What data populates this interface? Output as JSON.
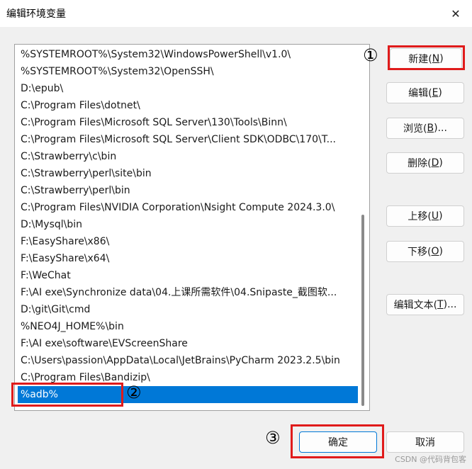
{
  "window": {
    "title": "编辑环境变量",
    "close_glyph": "✕"
  },
  "path_list": {
    "items": [
      "%SYSTEMROOT%\\System32\\WindowsPowerShell\\v1.0\\",
      "%SYSTEMROOT%\\System32\\OpenSSH\\",
      "D:\\epub\\",
      "C:\\Program Files\\dotnet\\",
      "C:\\Program Files\\Microsoft SQL Server\\130\\Tools\\Binn\\",
      "C:\\Program Files\\Microsoft SQL Server\\Client SDK\\ODBC\\170\\T...",
      "C:\\Strawberry\\c\\bin",
      "C:\\Strawberry\\perl\\site\\bin",
      "C:\\Strawberry\\perl\\bin",
      "C:\\Program Files\\NVIDIA Corporation\\Nsight Compute 2024.3.0\\",
      "D:\\Mysql\\bin",
      "F:\\EasyShare\\x86\\",
      "F:\\EasyShare\\x64\\",
      "F:\\WeChat",
      "F:\\AI exe\\Synchronize data\\04.上课所需软件\\04.Snipaste_截图软...",
      "D:\\git\\Git\\cmd",
      "%NEO4J_HOME%\\bin",
      "F:\\AI exe\\software\\EVScreenShare",
      "C:\\Users\\passion\\AppData\\Local\\JetBrains\\PyCharm 2023.2.5\\bin",
      "C:\\Program Files\\Bandizip\\",
      "%adb%"
    ],
    "selected_index": 20
  },
  "buttons": {
    "new": {
      "label": "新建(",
      "key": "N",
      "close": ")"
    },
    "edit": {
      "label": "编辑(",
      "key": "E",
      "close": ")"
    },
    "browse": {
      "label": "浏览(",
      "key": "B",
      "close": ")..."
    },
    "delete": {
      "label": "删除(",
      "key": "D",
      "close": ")"
    },
    "move_up": {
      "label": "上移(",
      "key": "U",
      "close": ")"
    },
    "move_down": {
      "label": "下移(",
      "key": "O",
      "close": ")"
    },
    "edit_text": {
      "label": "编辑文本(",
      "key": "T",
      "close": ")..."
    },
    "ok": {
      "label": "确定"
    },
    "cancel": {
      "label": "取消"
    }
  },
  "annotations": {
    "step1": "①",
    "step2": "②",
    "step3": "③",
    "highlight_color": "#e01b1b"
  },
  "watermark": "CSDN @代码背包客",
  "colors": {
    "selection": "#0078d7",
    "dialog_bg": "#f0f0f0"
  }
}
